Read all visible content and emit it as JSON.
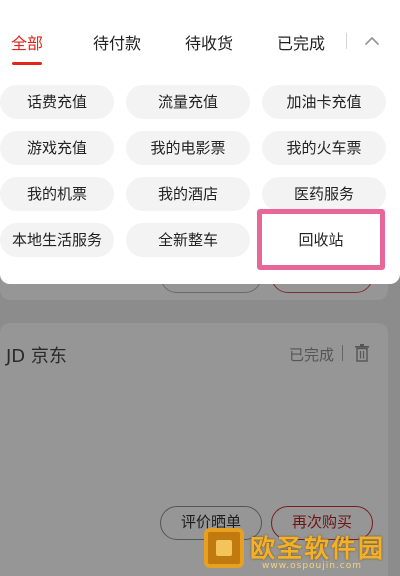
{
  "tabs": [
    {
      "label": "全部",
      "active": true
    },
    {
      "label": "待付款",
      "active": false
    },
    {
      "label": "待收货",
      "active": false
    },
    {
      "label": "已完成",
      "active": false
    }
  ],
  "collapse_icon": "chevron-up-icon",
  "filters": [
    "话费充值",
    "流量充值",
    "加油卡充值",
    "游戏充值",
    "我的电影票",
    "我的火车票",
    "我的机票",
    "我的酒店",
    "医药服务",
    "本地生活服务",
    "全新整车",
    "回收站"
  ],
  "highlighted_filter": "回收站",
  "highlight_color": "#e9669a",
  "accent_color": "#e1251b",
  "order": {
    "store": "JD 京东",
    "status": "已完成",
    "delete_icon": "trash-icon",
    "buttons": {
      "review": "评价晒单",
      "rebuy": "再次购买"
    }
  },
  "watermark": {
    "text": "欧圣软件园",
    "url": "www.ospoujin.com"
  }
}
